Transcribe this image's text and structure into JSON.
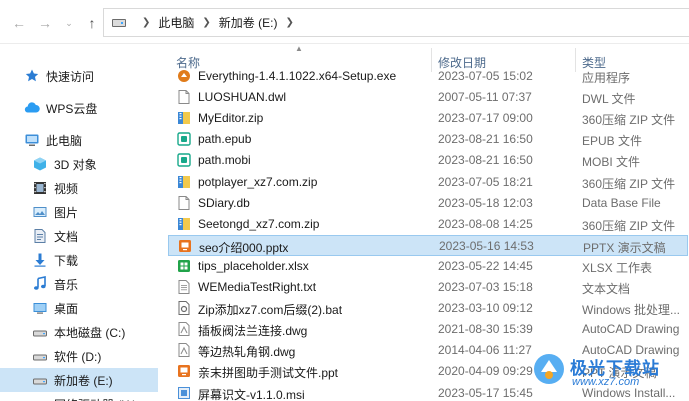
{
  "address": {
    "crumbs": [
      "此电脑",
      "新加卷 (E:)"
    ]
  },
  "sidebar": {
    "items": [
      {
        "label": "快速访问",
        "icon": "star-icon",
        "color": "#2b7cd3"
      },
      {
        "label": "WPS云盘",
        "icon": "cloud-icon",
        "color": "#2b9cf2"
      },
      {
        "label": "此电脑",
        "icon": "computer-icon",
        "color": "#3c8ed8"
      },
      {
        "label": "3D 对象",
        "icon": "cube-icon",
        "color": "#3fb1e8"
      },
      {
        "label": "视频",
        "icon": "film-icon",
        "color": "#4a4a4a"
      },
      {
        "label": "图片",
        "icon": "picture-icon",
        "color": "#4f8fc9"
      },
      {
        "label": "文档",
        "icon": "document-icon",
        "color": "#5b7fa6"
      },
      {
        "label": "下载",
        "icon": "download-icon",
        "color": "#2b7cd3"
      },
      {
        "label": "音乐",
        "icon": "music-icon",
        "color": "#2b7cd3"
      },
      {
        "label": "桌面",
        "icon": "desktop-icon",
        "color": "#3b8fd8"
      },
      {
        "label": "本地磁盘 (C:)",
        "icon": "drive-icon",
        "color": "#6b6b6b"
      },
      {
        "label": "软件 (D:)",
        "icon": "drive-icon",
        "color": "#6b6b6b"
      },
      {
        "label": "新加卷 (E:)",
        "icon": "drive-icon",
        "color": "#6b6b6b"
      },
      {
        "label": "网络驱动器 (X:)",
        "icon": "drive-icon",
        "color": "#6b6b6b"
      }
    ]
  },
  "columns": {
    "name": "名称",
    "date": "修改日期",
    "type": "类型"
  },
  "files": [
    {
      "name": "Everything-1.4.1.1022.x64-Setup.exe",
      "date": "2023-07-05 15:02",
      "type": "应用程序",
      "icon": "app-icon",
      "color": "#e07b1a"
    },
    {
      "name": "LUOSHUAN.dwl",
      "date": "2007-05-11 07:37",
      "type": "DWL 文件",
      "icon": "blank-file-icon",
      "color": "#8a8a8a"
    },
    {
      "name": "MyEditor.zip",
      "date": "2023-07-17 09:00",
      "type": "360压缩 ZIP 文件",
      "icon": "zip-icon",
      "color": "#3a87d6"
    },
    {
      "name": "path.epub",
      "date": "2023-08-21 16:50",
      "type": "EPUB 文件",
      "icon": "epub-icon",
      "color": "#17a88a"
    },
    {
      "name": "path.mobi",
      "date": "2023-08-21 16:50",
      "type": "MOBI 文件",
      "icon": "mobi-icon",
      "color": "#17a88a"
    },
    {
      "name": "potplayer_xz7.com.zip",
      "date": "2023-07-05 18:21",
      "type": "360压缩 ZIP 文件",
      "icon": "zip-icon",
      "color": "#3a87d6"
    },
    {
      "name": "SDiary.db",
      "date": "2023-05-18 12:03",
      "type": "Data Base File",
      "icon": "blank-file-icon",
      "color": "#8a8a8a"
    },
    {
      "name": "Seetongd_xz7.com.zip",
      "date": "2023-08-08 14:25",
      "type": "360压缩 ZIP 文件",
      "icon": "zip-icon",
      "color": "#3a87d6"
    },
    {
      "name": "seo介绍000.pptx",
      "date": "2023-05-16 14:53",
      "type": "PPTX 演示文稿",
      "icon": "pptx-icon",
      "color": "#e8731f",
      "selected": true
    },
    {
      "name": "tips_placeholder.xlsx",
      "date": "2023-05-22 14:45",
      "type": "XLSX 工作表",
      "icon": "xlsx-icon",
      "color": "#21a34a"
    },
    {
      "name": "WEMediaTestRight.txt",
      "date": "2023-07-03 15:18",
      "type": "文本文档",
      "icon": "txt-icon",
      "color": "#8a8a8a"
    },
    {
      "name": "Zip添加xz7.com后缀(2).bat",
      "date": "2023-03-10 09:12",
      "type": "Windows 批处理...",
      "icon": "bat-icon",
      "color": "#6b6b6b"
    },
    {
      "name": "插板阀法兰连接.dwg",
      "date": "2021-08-30 15:39",
      "type": "AutoCAD Drawing",
      "icon": "dwg-icon",
      "color": "#8a8a8a"
    },
    {
      "name": "等边热轧角钢.dwg",
      "date": "2014-04-06 11:27",
      "type": "AutoCAD Drawing",
      "icon": "dwg-icon",
      "color": "#8a8a8a"
    },
    {
      "name": "亲末拼图助手测试文件.ppt",
      "date": "2020-04-09 09:29",
      "type": "PPT 演示文稿",
      "icon": "ppt-icon",
      "color": "#e8731f"
    },
    {
      "name": "屏幕识文-v1.1.0.msi",
      "date": "2023-05-17 15:45",
      "type": "Windows Install...",
      "icon": "msi-icon",
      "color": "#4a90d9"
    }
  ],
  "watermark": {
    "title": "极光下载站",
    "url": "www.xz7.com"
  }
}
